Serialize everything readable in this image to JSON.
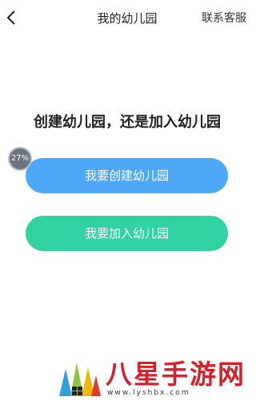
{
  "nav": {
    "title": "我的幼儿园",
    "service_label": "联系客服"
  },
  "main": {
    "question": "创建幼儿园，还是加入幼儿园",
    "create_button": "我要创建幼儿园",
    "join_button": "我要加入幼儿园"
  },
  "overlay": {
    "progress_label": "27%"
  },
  "watermark": {
    "brand": "八星手游网",
    "url": "www.lyshbx.com"
  },
  "colors": {
    "create": "#4da9f7",
    "join": "#2fd2a0",
    "brand": "#d8202a"
  }
}
